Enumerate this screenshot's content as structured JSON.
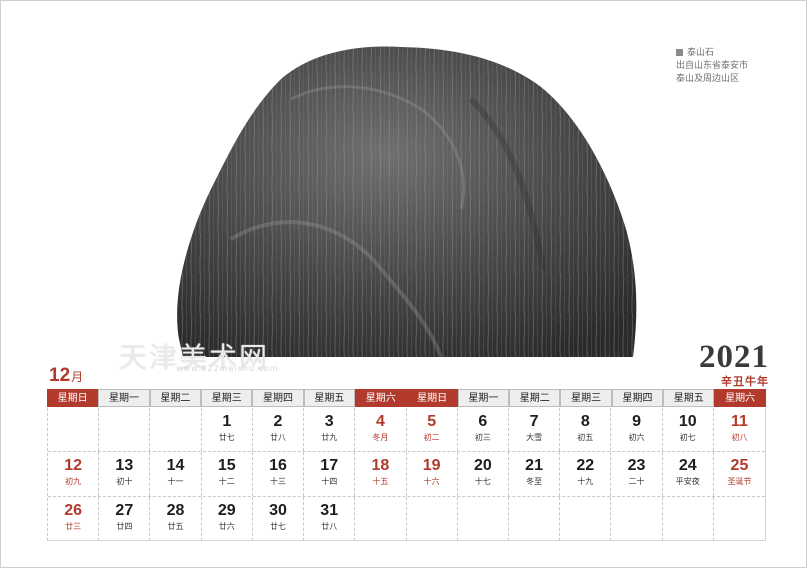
{
  "caption": {
    "title": "泰山石",
    "line2": "出自山东省泰安市",
    "line3": "泰山及周边山区"
  },
  "watermark": {
    "text": "天津美术网",
    "url": "www.022meishu.com"
  },
  "month": {
    "num": "12",
    "unit": "月"
  },
  "year": {
    "num": "2021",
    "cn": "辛丑牛年"
  },
  "colors": {
    "accent": "#b23a2c",
    "header_bg": "#eeeeee"
  },
  "weekdays": [
    {
      "label": "星期日",
      "red": true
    },
    {
      "label": "星期一",
      "red": false
    },
    {
      "label": "星期二",
      "red": false
    },
    {
      "label": "星期三",
      "red": false
    },
    {
      "label": "星期四",
      "red": false
    },
    {
      "label": "星期五",
      "red": false
    },
    {
      "label": "星期六",
      "red": true
    },
    {
      "label": "星期日",
      "red": true
    },
    {
      "label": "星期一",
      "red": false
    },
    {
      "label": "星期二",
      "red": false
    },
    {
      "label": "星期三",
      "red": false
    },
    {
      "label": "星期四",
      "red": false
    },
    {
      "label": "星期五",
      "red": false
    },
    {
      "label": "星期六",
      "red": true
    }
  ],
  "weeks": [
    [
      {
        "d": "",
        "l": "",
        "red": false
      },
      {
        "d": "",
        "l": "",
        "red": false
      },
      {
        "d": "",
        "l": "",
        "red": false
      },
      {
        "d": "1",
        "l": "廿七",
        "red": false
      },
      {
        "d": "2",
        "l": "廿八",
        "red": false
      },
      {
        "d": "3",
        "l": "廿九",
        "red": false
      },
      {
        "d": "4",
        "l": "冬月",
        "red": true
      },
      {
        "d": "5",
        "l": "初二",
        "red": true
      },
      {
        "d": "6",
        "l": "初三",
        "red": false
      },
      {
        "d": "7",
        "l": "大雪",
        "red": false
      },
      {
        "d": "8",
        "l": "初五",
        "red": false
      },
      {
        "d": "9",
        "l": "初六",
        "red": false
      },
      {
        "d": "10",
        "l": "初七",
        "red": false
      },
      {
        "d": "11",
        "l": "初八",
        "red": true
      }
    ],
    [
      {
        "d": "12",
        "l": "初九",
        "red": true
      },
      {
        "d": "13",
        "l": "初十",
        "red": false
      },
      {
        "d": "14",
        "l": "十一",
        "red": false
      },
      {
        "d": "15",
        "l": "十二",
        "red": false
      },
      {
        "d": "16",
        "l": "十三",
        "red": false
      },
      {
        "d": "17",
        "l": "十四",
        "red": false
      },
      {
        "d": "18",
        "l": "十五",
        "red": true
      },
      {
        "d": "19",
        "l": "十六",
        "red": true
      },
      {
        "d": "20",
        "l": "十七",
        "red": false
      },
      {
        "d": "21",
        "l": "冬至",
        "red": false
      },
      {
        "d": "22",
        "l": "十九",
        "red": false
      },
      {
        "d": "23",
        "l": "二十",
        "red": false
      },
      {
        "d": "24",
        "l": "平安夜",
        "red": false
      },
      {
        "d": "25",
        "l": "圣诞节",
        "red": true
      }
    ],
    [
      {
        "d": "26",
        "l": "廿三",
        "red": true
      },
      {
        "d": "27",
        "l": "廿四",
        "red": false
      },
      {
        "d": "28",
        "l": "廿五",
        "red": false
      },
      {
        "d": "29",
        "l": "廿六",
        "red": false
      },
      {
        "d": "30",
        "l": "廿七",
        "red": false
      },
      {
        "d": "31",
        "l": "廿八",
        "red": false
      },
      {
        "d": "",
        "l": "",
        "red": false
      },
      {
        "d": "",
        "l": "",
        "red": false
      },
      {
        "d": "",
        "l": "",
        "red": false
      },
      {
        "d": "",
        "l": "",
        "red": false
      },
      {
        "d": "",
        "l": "",
        "red": false
      },
      {
        "d": "",
        "l": "",
        "red": false
      },
      {
        "d": "",
        "l": "",
        "red": false
      },
      {
        "d": "",
        "l": "",
        "red": false
      }
    ]
  ]
}
